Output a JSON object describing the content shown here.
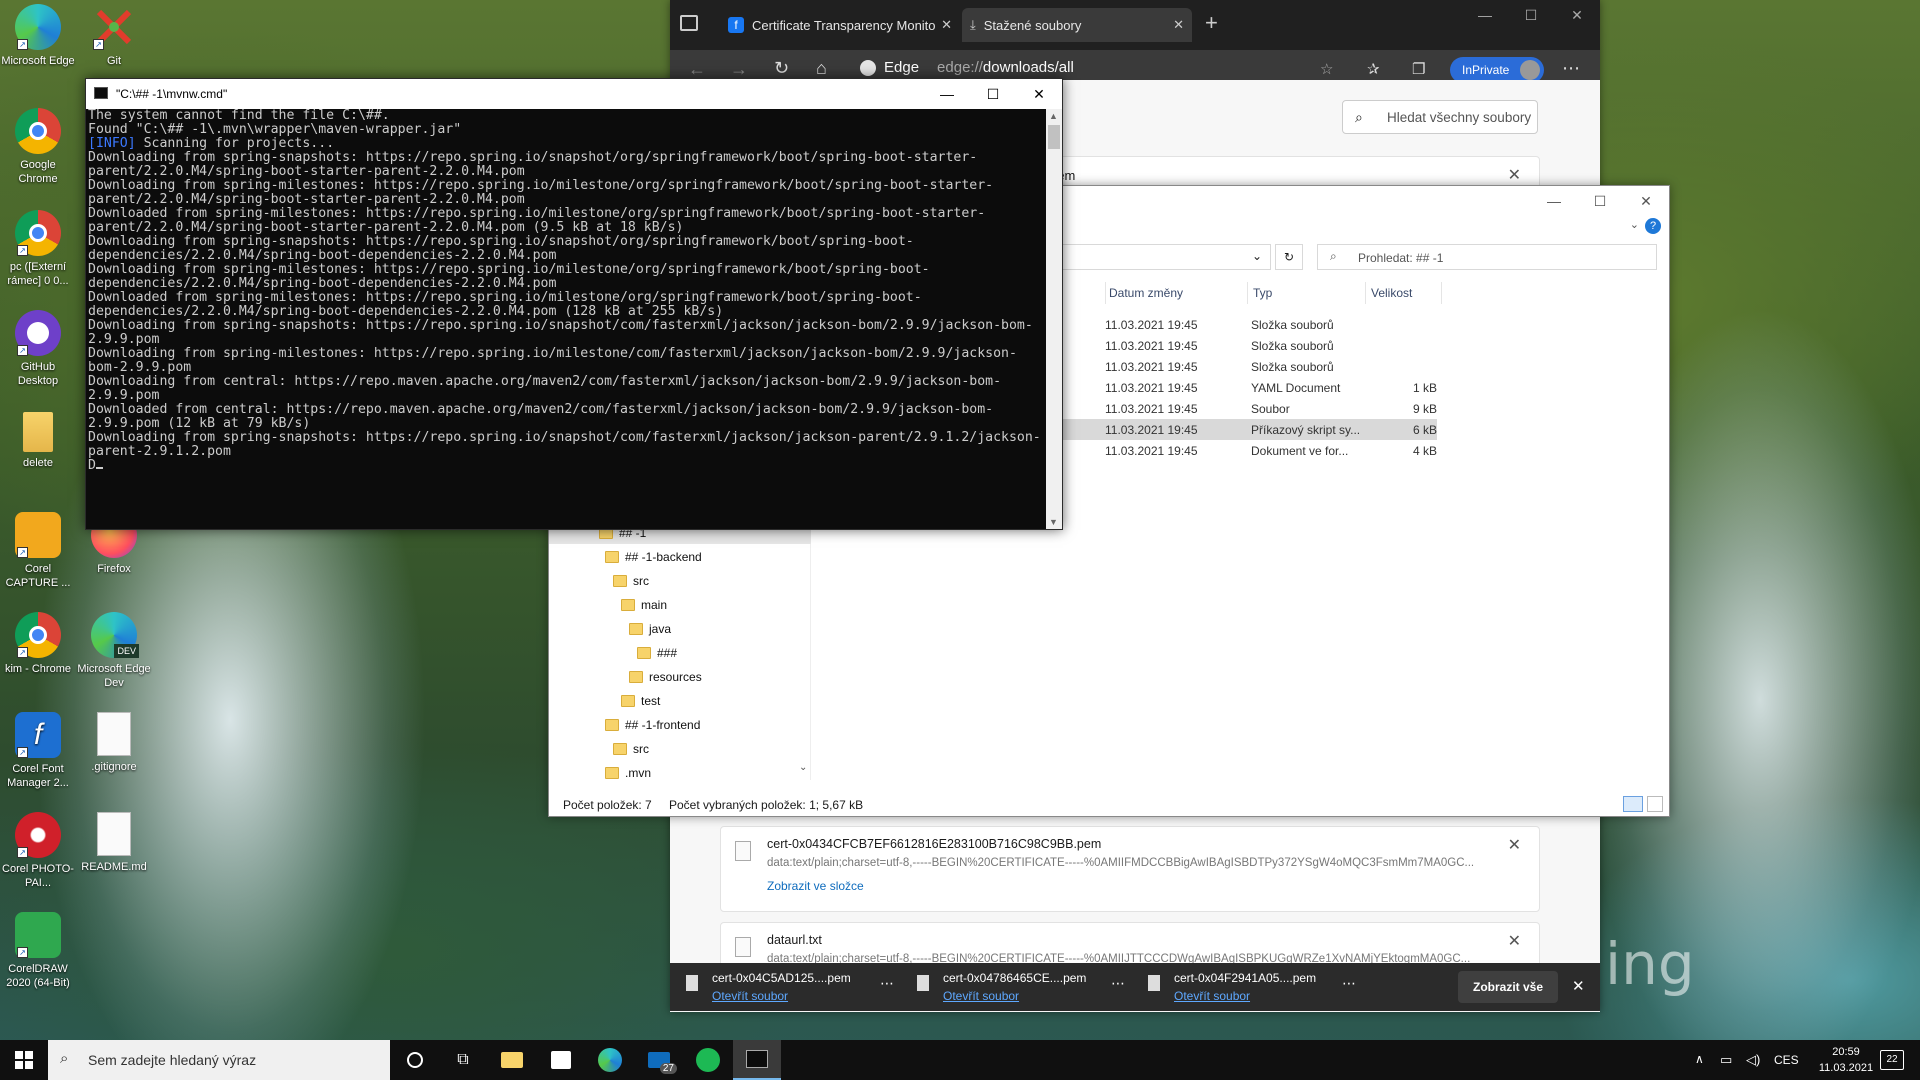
{
  "desktop": {
    "icons": [
      {
        "label": "Microsoft Edge"
      },
      {
        "label": "Git"
      },
      {
        "label": "Google Chrome"
      },
      {
        "label": "pc ([Externí rámec] 0 0..."
      },
      {
        "label": "GitHub Desktop"
      },
      {
        "label": "delete"
      },
      {
        "label": "Corel CAPTURE ..."
      },
      {
        "label": "Firefox"
      },
      {
        "label": "kim - Chrome"
      },
      {
        "label": "Microsoft Edge Dev"
      },
      {
        "label": "Corel Font Manager 2..."
      },
      {
        "label": ".gitignore"
      },
      {
        "label": "Corel PHOTO-PAI..."
      },
      {
        "label": "README.md"
      },
      {
        "label": "CorelDRAW 2020 (64-Bit)"
      }
    ],
    "wallpaper_text": "ing"
  },
  "edge": {
    "tabs": [
      {
        "label": "Certificate Transparency Monito"
      },
      {
        "label": "Stažené soubory"
      }
    ],
    "edge_label": "Edge",
    "url_prefix": "edge://",
    "url_rest": "downloads/all",
    "inprivate": "InPrivate",
    "search_placeholder": "Hledat všechny soubory",
    "partial_filename": "34.pem",
    "downloads": [
      {
        "name": "cert-0x0434CFCB7EF6612816E283100B716C98C9BB.pem",
        "url": "data:text/plain;charset=utf-8,-----BEGIN%20CERTIFICATE-----%0AMIIFMDCCBBigAwIBAgISBDTPy372YSgW4oMQC3FsmMm7MA0GC...",
        "action": "Zobrazit ve složce"
      },
      {
        "name": "dataurl.txt",
        "url": "data:text/plain;charset=utf-8,-----BEGIN%20CERTIFICATE-----%0AMIIJTTCCCDWgAwIBAgISBPKUGgWRZe1XvNAMjYEktogmMA0GC..."
      }
    ],
    "shelf": {
      "items": [
        {
          "name": "cert-0x04C5AD125....pem",
          "action": "Otevřít soubor"
        },
        {
          "name": "cert-0x04786465CE....pem",
          "action": "Otevřít soubor"
        },
        {
          "name": "cert-0x04F2941A05....pem",
          "action": "Otevřít soubor"
        }
      ],
      "show_all": "Zobrazit vše"
    }
  },
  "explorer": {
    "search_placeholder": "Prohledat: ## -1",
    "columns": [
      "Datum změny",
      "Typ",
      "Velikost"
    ],
    "files": [
      {
        "date": "11.03.2021 19:45",
        "type": "Složka souborů",
        "size": ""
      },
      {
        "date": "11.03.2021 19:45",
        "type": "Složka souborů",
        "size": ""
      },
      {
        "date": "11.03.2021 19:45",
        "type": "Složka souborů",
        "size": ""
      },
      {
        "date": "11.03.2021 19:45",
        "type": "YAML Document",
        "size": "1 kB"
      },
      {
        "date": "11.03.2021 19:45",
        "type": "Soubor",
        "size": "9 kB"
      },
      {
        "date": "11.03.2021 19:45",
        "type": "Příkazový skript sy...",
        "size": "6 kB"
      },
      {
        "date": "11.03.2021 19:45",
        "type": "Dokument ve for...",
        "size": "4 kB"
      }
    ],
    "tree": [
      {
        "label": "## -1",
        "indent": 0
      },
      {
        "label": "## -1-backend",
        "indent": 1
      },
      {
        "label": "src",
        "indent": 2
      },
      {
        "label": "main",
        "indent": 3
      },
      {
        "label": "java",
        "indent": 4
      },
      {
        "label": "###",
        "indent": 5
      },
      {
        "label": "resources",
        "indent": 4
      },
      {
        "label": "test",
        "indent": 3
      },
      {
        "label": "## -1-frontend",
        "indent": 1
      },
      {
        "label": "src",
        "indent": 2
      },
      {
        "label": ".mvn",
        "indent": 1
      }
    ],
    "status_count": "Počet položek: 7",
    "status_selected": "Počet vybraných položek: 1; 5,67 kB"
  },
  "cmd": {
    "title": "\"C:\\## -1\\mvnw.cmd\"",
    "lines": [
      "The system cannot find the file C:\\##.",
      "Found \"C:\\## -1\\.mvn\\wrapper\\maven-wrapper.jar\"",
      "[INFO] Scanning for projects...",
      "Downloading from spring-snapshots: https://repo.spring.io/snapshot/org/springframework/boot/spring-boot-starter-parent/2.2.0.M4/spring-boot-starter-parent-2.2.0.M4.pom",
      "Downloading from spring-milestones: https://repo.spring.io/milestone/org/springframework/boot/spring-boot-starter-parent/2.2.0.M4/spring-boot-starter-parent-2.2.0.M4.pom",
      "Downloaded from spring-milestones: https://repo.spring.io/milestone/org/springframework/boot/spring-boot-starter-parent/2.2.0.M4/spring-boot-starter-parent-2.2.0.M4.pom (9.5 kB at 18 kB/s)",
      "Downloading from spring-snapshots: https://repo.spring.io/snapshot/org/springframework/boot/spring-boot-dependencies/2.2.0.M4/spring-boot-dependencies-2.2.0.M4.pom",
      "Downloading from spring-milestones: https://repo.spring.io/milestone/org/springframework/boot/spring-boot-dependencies/2.2.0.M4/spring-boot-dependencies-2.2.0.M4.pom",
      "Downloaded from spring-milestones: https://repo.spring.io/milestone/org/springframework/boot/spring-boot-dependencies/2.2.0.M4/spring-boot-dependencies-2.2.0.M4.pom (128 kB at 255 kB/s)",
      "Downloading from spring-snapshots: https://repo.spring.io/snapshot/com/fasterxml/jackson/jackson-bom/2.9.9/jackson-bom-2.9.9.pom",
      "Downloading from spring-milestones: https://repo.spring.io/milestone/com/fasterxml/jackson/jackson-bom/2.9.9/jackson-bom-2.9.9.pom",
      "Downloading from central: https://repo.maven.apache.org/maven2/com/fasterxml/jackson/jackson-bom/2.9.9/jackson-bom-2.9.9.pom",
      "Downloaded from central: https://repo.maven.apache.org/maven2/com/fasterxml/jackson/jackson-bom/2.9.9/jackson-bom-2.9.9.pom (12 kB at 79 kB/s)",
      "Downloading from spring-snapshots: https://repo.spring.io/snapshot/com/fasterxml/jackson/jackson-parent/2.9.1.2/jackson-parent-2.9.1.2.pom",
      "D"
    ]
  },
  "taskbar": {
    "search_placeholder": "Sem zadejte hledaný výraz",
    "mail_badge": "27",
    "lang": "CES",
    "time": "20:59",
    "date": "11.03.2021",
    "notif_count": "22"
  },
  "colors": {
    "edge_accent": "#1a73e8",
    "inprivate_bg": "#2b6cd8",
    "cmd_bg": "#0c0c0c",
    "cmd_text": "#cccccc",
    "info_blue": "#3b78ff"
  }
}
